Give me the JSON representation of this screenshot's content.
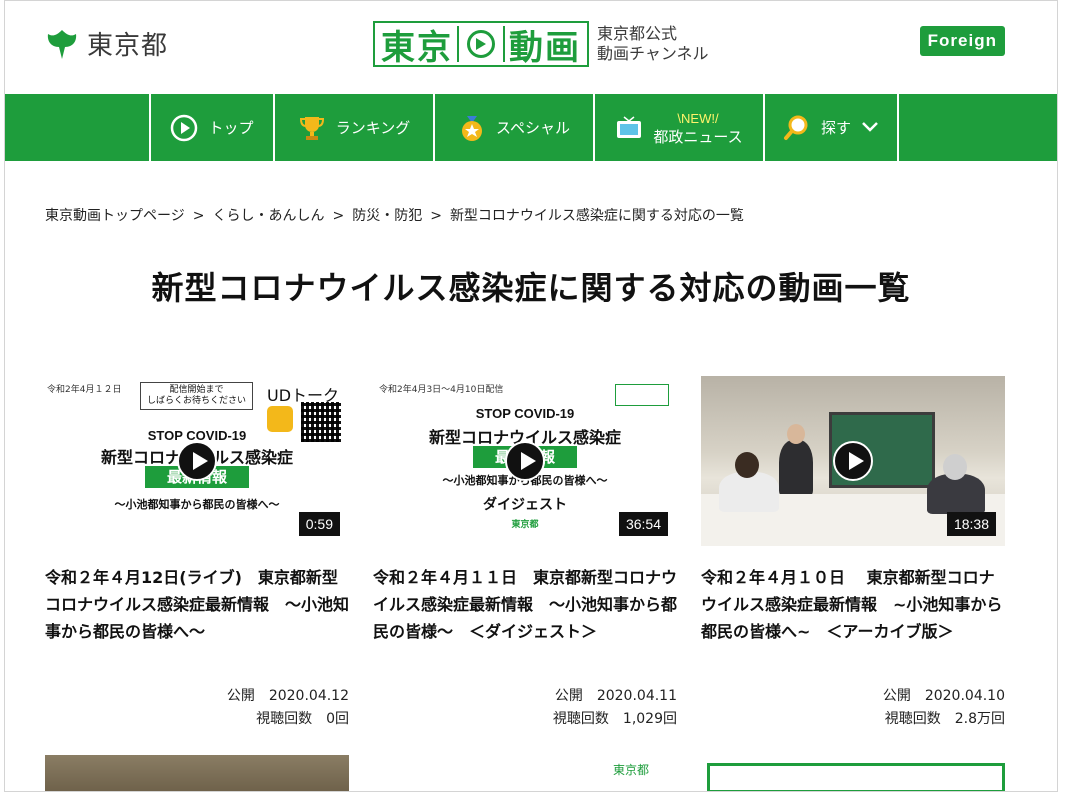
{
  "header": {
    "logo_text": "東京都",
    "brand_left": "東京",
    "brand_right": "動画",
    "brand_sub_line1": "東京都公式",
    "brand_sub_line2": "動画チャンネル",
    "foreign_button": "Foreign",
    "accent_color": "#1e9d3c"
  },
  "nav": {
    "items": [
      {
        "label": "トップ",
        "icon": "play-circle-icon"
      },
      {
        "label": "ランキング",
        "icon": "trophy-icon"
      },
      {
        "label": "スペシャル",
        "icon": "star-medal-icon"
      },
      {
        "label": "都政ニュース",
        "badge": "\\NEW!/",
        "icon": "tv-icon"
      },
      {
        "label": "探す",
        "icon": "magnifier-icon"
      }
    ]
  },
  "breadcrumb": [
    "東京動画トップページ",
    "くらし・あんしん",
    "防災・防犯",
    "新型コロナウイルス感染症に関する対応の一覧"
  ],
  "page_title": "新型コロナウイルス感染症に関する対応の動画一覧",
  "videos": [
    {
      "duration": "0:59",
      "title": "令和２年４月12日(ライブ)　東京都新型コロナウイルス感染症最新情報　～小池知事から都民の皆様へ～",
      "published_label": "公開",
      "published": "2020.04.12",
      "views_label": "視聴回数",
      "views": "0回",
      "thumb": {
        "date": "令和2年4月１２日",
        "notice_line1": "配信開始まで",
        "notice_line2": "しばらくお待ちください",
        "ud": "UDトーク",
        "stop": "STOP COVID-19",
        "headline": "新型コロナウイルス感染症",
        "green": "最新情報",
        "sub": "～小池都知事から都民の皆様へ～"
      }
    },
    {
      "duration": "36:54",
      "title": "令和２年４月１１日　東京都新型コロナウイルス感染症最新情報　～小池知事から都民の皆様～　＜ダイジェスト＞",
      "published_label": "公開",
      "published": "2020.04.11",
      "views_label": "視聴回数",
      "views": "1,029回",
      "thumb": {
        "date": "令和2年4月3日～4月10日配信",
        "stop": "STOP COVID-19",
        "headline": "新型コロナウイルス感染症",
        "green": "最新情報",
        "sub": "～小池都知事から都民の皆様へ～",
        "digest": "ダイジェスト",
        "org": "東京都"
      }
    },
    {
      "duration": "18:38",
      "title": "令和２年４月１０日　 東京都新型コロナウイルス感染症最新情報　~小池知事から都民の皆様へ~　＜アーカイブ版＞",
      "published_label": "公開",
      "published": "2020.04.10",
      "views_label": "視聴回数",
      "views": "2.8万回",
      "thumb": {}
    }
  ],
  "partial_row_text": "東京都"
}
